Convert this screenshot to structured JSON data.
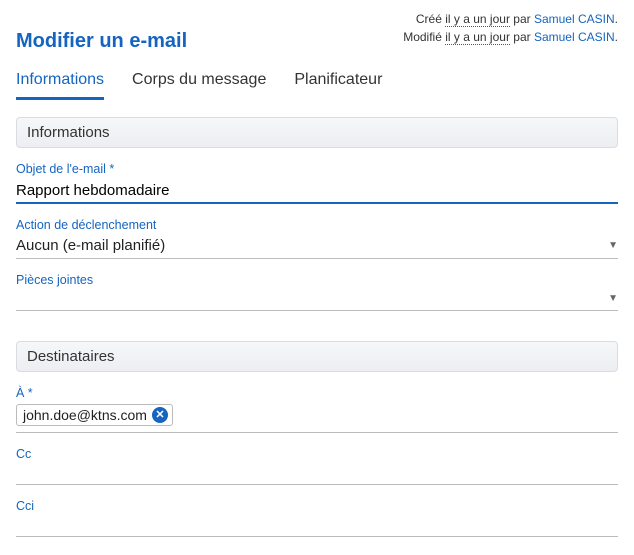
{
  "header": {
    "title": "Modifier un e-mail",
    "created_prefix": "Créé ",
    "created_time": "il y a un jour",
    "created_by_prefix": " par ",
    "created_by": "Samuel CASIN",
    "modified_prefix": "Modifié ",
    "modified_time": "il y a un jour",
    "modified_by_prefix": " par ",
    "modified_by": "Samuel CASIN",
    "period": "."
  },
  "tabs": {
    "informations": "Informations",
    "corps": "Corps du message",
    "planificateur": "Planificateur"
  },
  "sections": {
    "informations": "Informations",
    "destinataires": "Destinataires"
  },
  "fields": {
    "subject_label": "Objet de l'e-mail *",
    "subject_value": "Rapport hebdomadaire",
    "trigger_label": "Action de déclenchement",
    "trigger_value": "Aucun (e-mail planifié)",
    "attachments_label": "Pièces jointes",
    "to_label": "À *",
    "to_chip": "john.doe@ktns.com",
    "cc_label": "Cc",
    "cci_label": "Cci"
  }
}
